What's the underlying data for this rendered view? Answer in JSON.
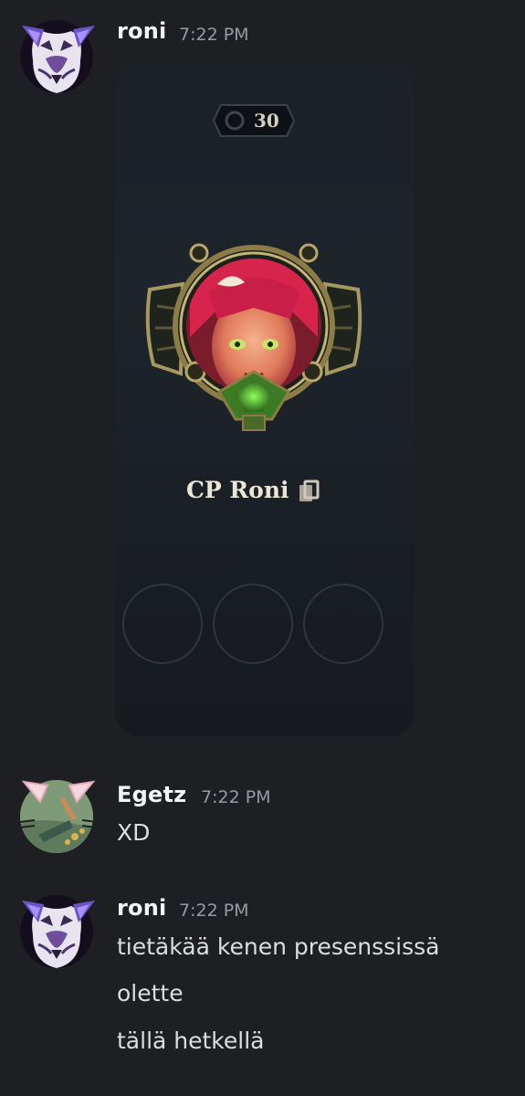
{
  "messages": [
    {
      "author": "roni",
      "time": "7:22 PM",
      "avatar_icon": "cat-avatar-icon",
      "card": {
        "level": "30",
        "summoner_name": "CP Roni",
        "copy_icon": "copy-icon",
        "empty_slots": 3
      }
    },
    {
      "author": "Egetz",
      "time": "7:22 PM",
      "avatar_icon": "cat-ears-avatar-icon",
      "lines": [
        "XD"
      ]
    },
    {
      "author": "roni",
      "time": "7:22 PM",
      "avatar_icon": "cat-avatar-icon",
      "lines": [
        "tietäkää kenen presenssissä",
        "olette",
        "tällä hetkellä"
      ]
    }
  ],
  "colors": {
    "background": "#1e1f22",
    "username": "#f2f3f5",
    "timestamp": "#949ba4",
    "text": "#dbdee1"
  }
}
